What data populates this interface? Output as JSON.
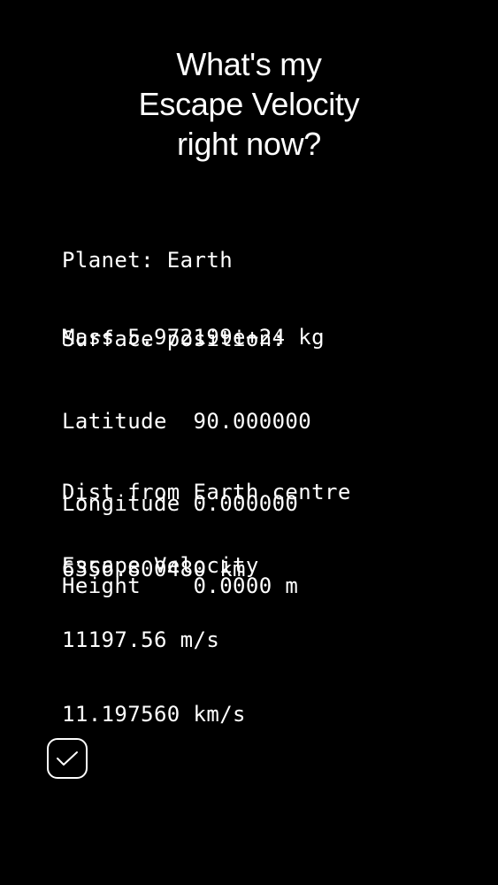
{
  "header": {
    "title_lines": [
      "What's my",
      "Escape Velocity",
      "right now?"
    ]
  },
  "planet": {
    "name_line": "Planet: Earth",
    "mass_line": "Mass 5.972199e+24 kg"
  },
  "surface": {
    "heading": "Surface position:",
    "latitude_line": "Latitude  90.000000",
    "longitude_line": "Longitude 0.000000",
    "height_line": "Height    0.0000 m"
  },
  "distance": {
    "heading": "Dist from Earth centre",
    "value_line": "6356.800480 km"
  },
  "escape": {
    "heading": "Escape Velocity",
    "ms_line": "11197.56 m/s",
    "kms_line": "11.197560 km/s"
  },
  "controls": {
    "confirm_icon": "checkmark-icon"
  },
  "colors": {
    "background": "#000000",
    "text": "#ffffff"
  }
}
